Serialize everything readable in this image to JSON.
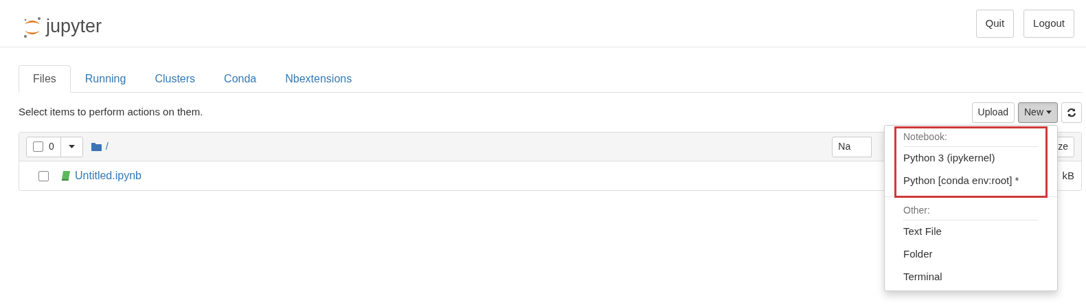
{
  "header": {
    "logo_text": "jupyter",
    "buttons": [
      "Quit",
      "Logout"
    ]
  },
  "tabs": [
    {
      "label": "Files",
      "selected": true
    },
    {
      "label": "Running",
      "selected": false
    },
    {
      "label": "Clusters",
      "selected": false
    },
    {
      "label": "Conda",
      "selected": false
    },
    {
      "label": "Nbextensions",
      "selected": false
    }
  ],
  "hint": "Select items to perform actions on them.",
  "toolbar": {
    "upload": "Upload",
    "new_button": {
      "label": "New",
      "expanded": true
    }
  },
  "list_header": {
    "all_checked": false,
    "selected_count": "0",
    "path": "/",
    "column_buttons": [
      "Na",
      "ze"
    ]
  },
  "rows": [
    {
      "name": "Untitled.ipynb",
      "checked": false,
      "size": "kB"
    }
  ],
  "new_menu": [
    {
      "heading": "Notebook:",
      "highlighted": true,
      "items": [
        "Python 3 (ipykernel)",
        "Python [conda env:root] *"
      ]
    },
    {
      "heading": "Other:",
      "highlighted": false,
      "items": [
        "Text File",
        "Folder",
        "Terminal"
      ]
    }
  ]
}
